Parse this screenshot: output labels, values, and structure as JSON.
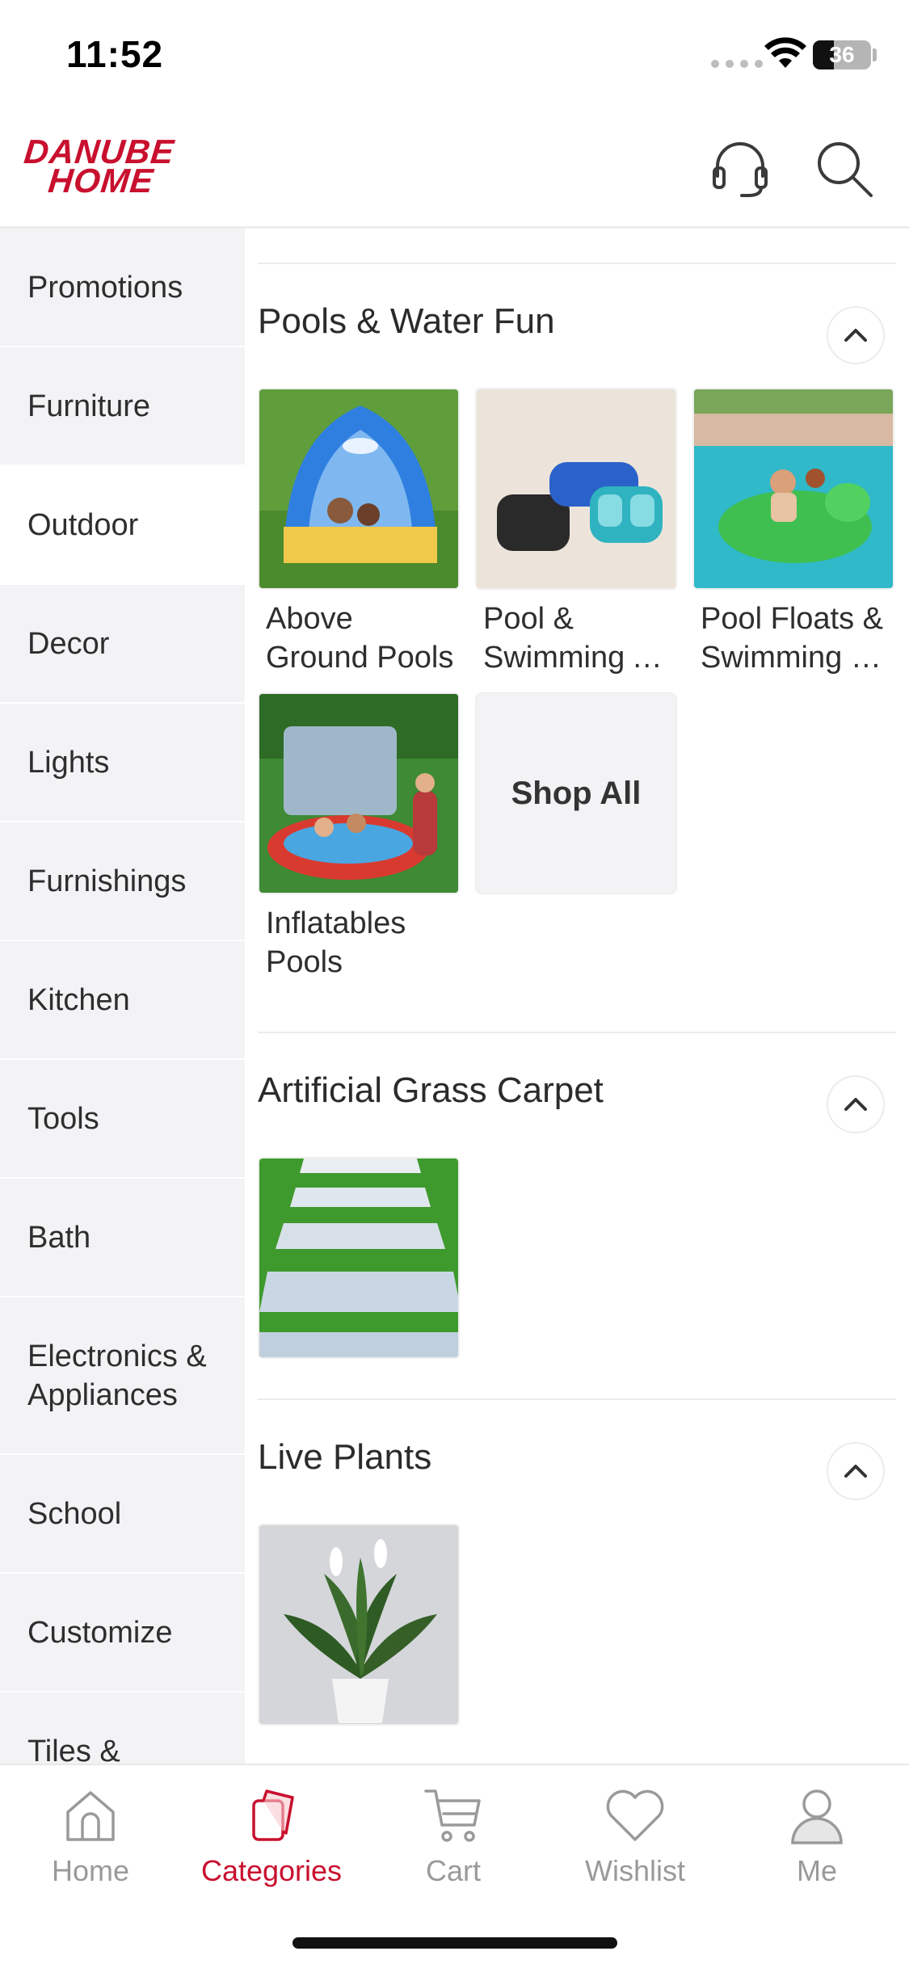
{
  "status_bar": {
    "time": "11:52",
    "battery": "36",
    "battery_level": 0.36
  },
  "header": {
    "logo_line1": "DANUBE",
    "logo_line2": "HOME"
  },
  "sidebar": {
    "items": [
      {
        "label": "Promotions"
      },
      {
        "label": "Furniture"
      },
      {
        "label": "Outdoor"
      },
      {
        "label": "Decor"
      },
      {
        "label": "Lights"
      },
      {
        "label": "Furnishings"
      },
      {
        "label": "Kitchen"
      },
      {
        "label": "Tools"
      },
      {
        "label": "Bath"
      },
      {
        "label": "Electronics & Appliances"
      },
      {
        "label": "School"
      },
      {
        "label": "Customize"
      },
      {
        "label": "Tiles &"
      }
    ],
    "active_index": 2
  },
  "sections": [
    {
      "title": "Pools & Water Fun",
      "tiles": [
        {
          "label_line1": "Above",
          "label_line2": "Ground Pools"
        },
        {
          "label_line1": "Pool &",
          "label_line2": "Swimming A..."
        },
        {
          "label_line1": "Pool Floats &",
          "label_line2": "Swimming R..."
        },
        {
          "label_line1": "Inflatables",
          "label_line2": "Pools"
        }
      ],
      "shop_all": "Shop All"
    },
    {
      "title": "Artificial Grass Carpet"
    },
    {
      "title": "Live Plants"
    }
  ],
  "bottom_nav": [
    {
      "label": "Home"
    },
    {
      "label": "Categories"
    },
    {
      "label": "Cart"
    },
    {
      "label": "Wishlist"
    },
    {
      "label": "Me"
    }
  ],
  "colors": {
    "accent": "#c8102e",
    "sidebar_bg": "#f3f3f6",
    "inactive": "#9a9a9a"
  }
}
